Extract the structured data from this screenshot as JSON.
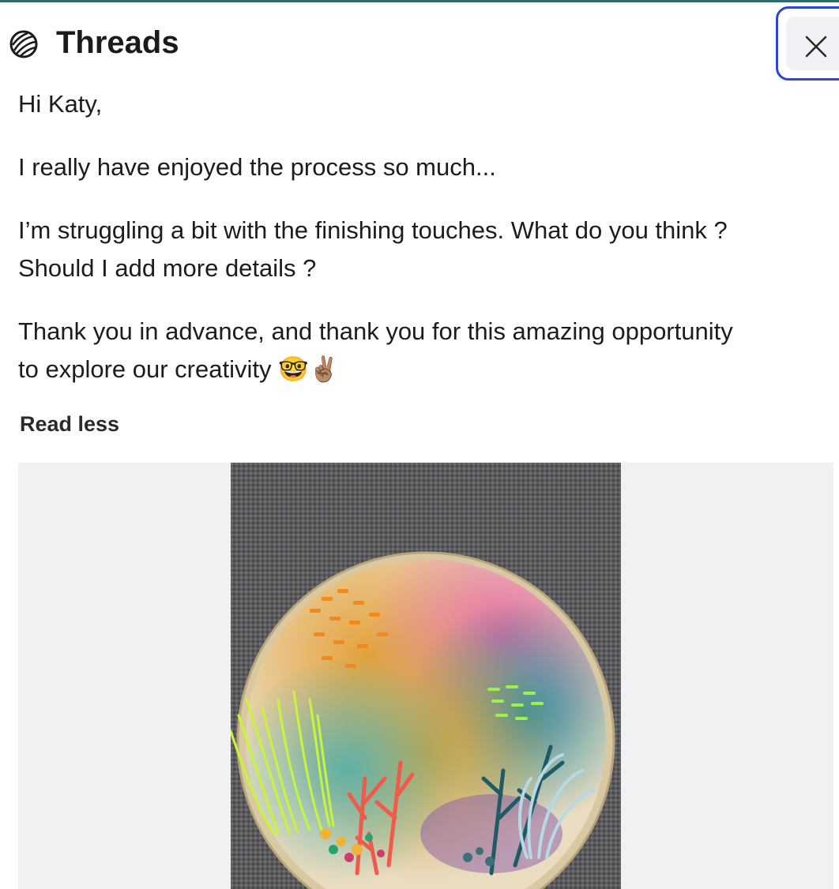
{
  "header": {
    "title": "Threads",
    "logo_icon": "yarn-ball-icon",
    "close_icon": "close-icon",
    "accent_color": "#2f47c9"
  },
  "message": {
    "greeting": "Hi Katy,",
    "line1": "I really have enjoyed the process so much...",
    "line2a": "I’m struggling a bit with the finishing touches. What do you think ?",
    "line2b": "Should I add more details ?",
    "line3a": "Thank you in advance, and thank you for this amazing opportunity",
    "line3b": "to explore our creativity",
    "emojis": "🤓✌🏽"
  },
  "read_less_label": "Read less",
  "image": {
    "subject": "embroidery-hoop-photo"
  }
}
